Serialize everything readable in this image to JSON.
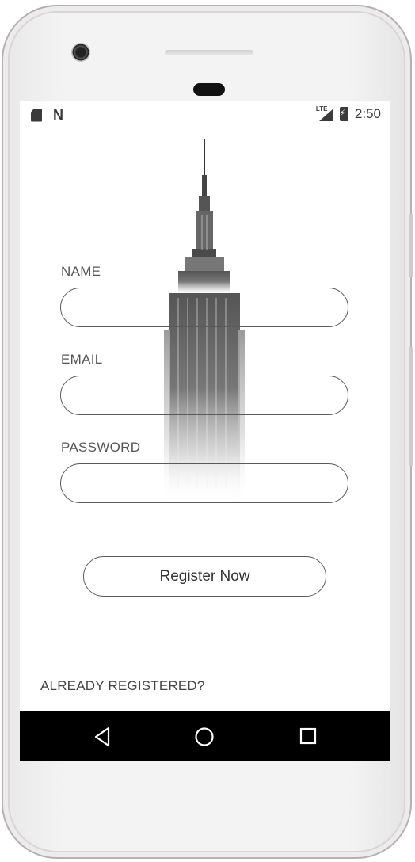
{
  "status_bar": {
    "network": "LTE",
    "time": "2:50",
    "icons": [
      "sdcard-icon",
      "n-notification-icon",
      "lte-signal-icon",
      "battery-charging-icon"
    ]
  },
  "form": {
    "name_label": "NAME",
    "email_label": "EMAIL",
    "password_label": "PASSWORD",
    "name_value": "",
    "email_value": "",
    "password_value": ""
  },
  "register_button": {
    "label": "Register Now"
  },
  "already_registered": {
    "label": "ALREADY REGISTERED?"
  },
  "nav": {
    "icons": [
      "back-icon",
      "home-icon",
      "recents-icon"
    ]
  },
  "colors": {
    "outline": "#5a5a5a",
    "text": "#444444",
    "nav_bg": "#000000"
  }
}
